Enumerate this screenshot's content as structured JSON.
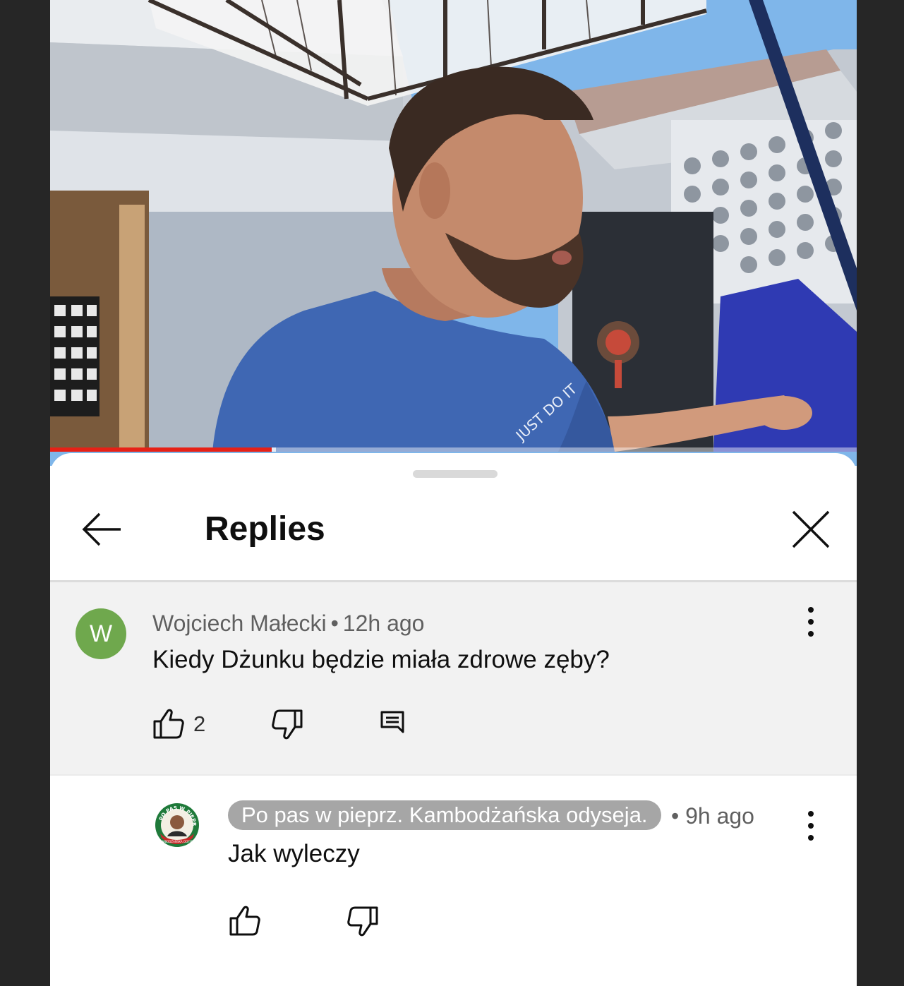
{
  "header": {
    "title": "Replies"
  },
  "video": {
    "shirt_text": "JUST DO IT",
    "progress_fraction": 0.275,
    "buffer_fraction": 0.28
  },
  "parent_comment": {
    "avatar_letter": "W",
    "author": "Wojciech Małecki",
    "separator": "•",
    "time": "12h ago",
    "text": "Kiedy Dżunku będzie miała zdrowe zęby?",
    "like_count": "2"
  },
  "reply": {
    "channel_name": "Po pas w pieprz. Kambodżańska odyseja.",
    "time": "• 9h ago",
    "text": "Jak wyleczy",
    "avatar_text_top": "PO PAS W PIEPRZ",
    "avatar_text_bottom": "KAMBODŻAŃSKA ODYSEJA"
  },
  "colors": {
    "progress": "#e62117",
    "avatar_w": "#6fa84d",
    "chip": "#a6a6a6",
    "parent_bg": "#f2f2f2"
  },
  "icons": [
    "back-arrow-icon",
    "close-icon",
    "more-vert-icon",
    "thumb-up-icon",
    "thumb-down-icon",
    "reply-icon"
  ]
}
